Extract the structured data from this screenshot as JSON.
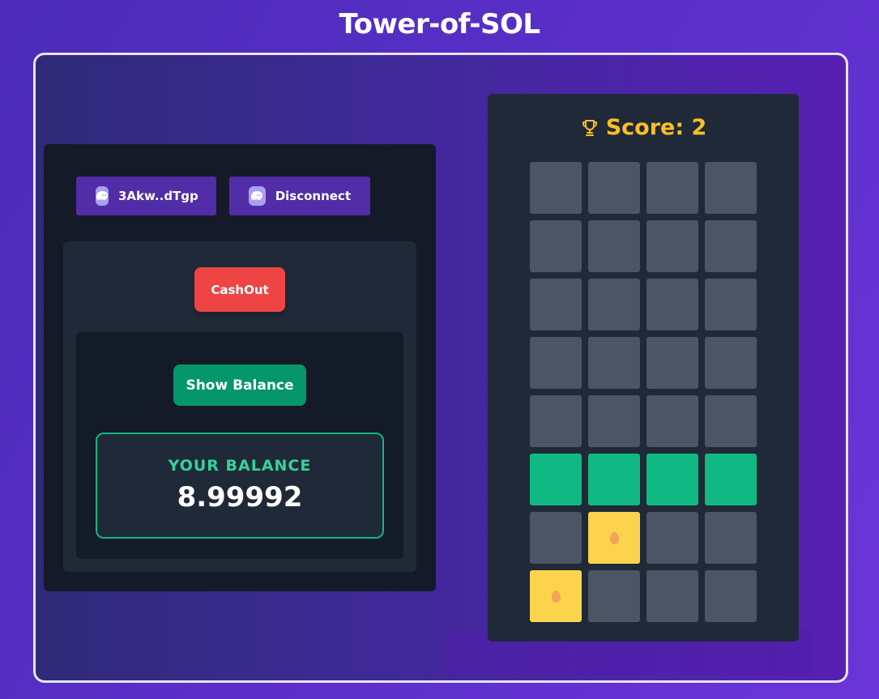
{
  "app": {
    "title": "Tower-of-SOL"
  },
  "wallet": {
    "address_label": "3Akw..dTgp",
    "disconnect_label": "Disconnect",
    "icon": "phantom-ghost-icon"
  },
  "actions": {
    "cashout_label": "CashOut",
    "show_balance_label": "Show Balance"
  },
  "balance": {
    "label": "YOUR BALANCE",
    "value": "8.99992"
  },
  "game": {
    "score_label": "Score: 2",
    "score": 2,
    "score_icon": "trophy-icon",
    "grid": [
      [
        "empty",
        "empty",
        "empty",
        "empty"
      ],
      [
        "empty",
        "empty",
        "empty",
        "empty"
      ],
      [
        "empty",
        "empty",
        "empty",
        "empty"
      ],
      [
        "empty",
        "empty",
        "empty",
        "empty"
      ],
      [
        "empty",
        "empty",
        "empty",
        "empty"
      ],
      [
        "active",
        "active",
        "active",
        "active"
      ],
      [
        "empty",
        "egg",
        "empty",
        "empty"
      ],
      [
        "egg",
        "empty",
        "empty",
        "empty"
      ]
    ]
  },
  "colors": {
    "cell_empty": "#4b5563",
    "cell_active": "#10b981",
    "cell_egg": "#fcd34d",
    "cashout": "#ef4444",
    "show_balance": "#059669",
    "wallet_button": "#512da8",
    "score": "#fbbf24"
  }
}
